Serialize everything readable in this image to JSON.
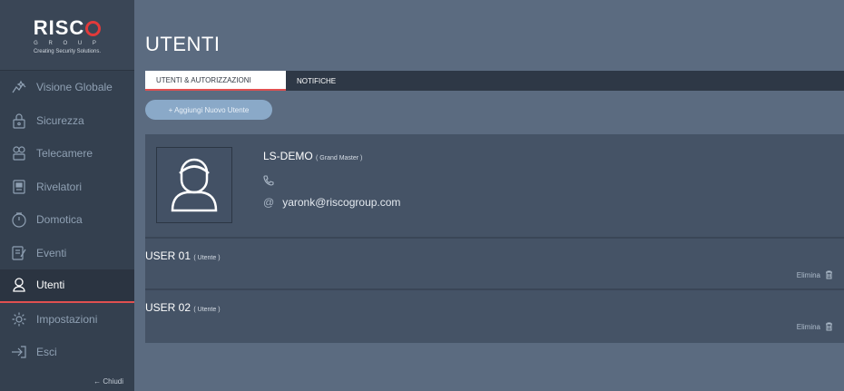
{
  "brand": {
    "word": "RISC",
    "group": "G R O U P",
    "tagline": "Creating Security Solutions."
  },
  "sidebar": {
    "items": [
      {
        "label": "Visione Globale",
        "icon": "overview-icon"
      },
      {
        "label": "Sicurezza",
        "icon": "padlock-icon"
      },
      {
        "label": "Telecamere",
        "icon": "camera-icon"
      },
      {
        "label": "Rivelatori",
        "icon": "detector-icon"
      },
      {
        "label": "Domotica",
        "icon": "home-automation-icon"
      },
      {
        "label": "Eventi",
        "icon": "events-icon"
      },
      {
        "label": "Utenti",
        "icon": "user-icon",
        "active": true
      },
      {
        "label": "Impostazioni",
        "icon": "gear-icon"
      },
      {
        "label": "Esci",
        "icon": "exit-icon"
      }
    ],
    "close_label": "← Chiudi"
  },
  "page": {
    "title": "UTENTI",
    "tabs": [
      {
        "label": "UTENTI & AUTORIZZAZIONI",
        "active": true
      },
      {
        "label": "NOTIFICHE",
        "active": false
      }
    ],
    "add_button": "+ Aggiungi Nuovo Utente"
  },
  "master_user": {
    "name": "LS-DEMO",
    "role": "( Grand Master )",
    "email": "yaronk@riscogroup.com",
    "email_icon": "@"
  },
  "users": [
    {
      "name": "USER 01",
      "role": "( Utente )",
      "delete_label": "Elimina"
    },
    {
      "name": "USER 02",
      "role": "( Utente )",
      "delete_label": "Elimina"
    }
  ],
  "colors": {
    "sidebar_bg": "#34404f",
    "main_bg": "#5b6b80",
    "accent": "#e05050",
    "button": "#8aa9c8"
  }
}
